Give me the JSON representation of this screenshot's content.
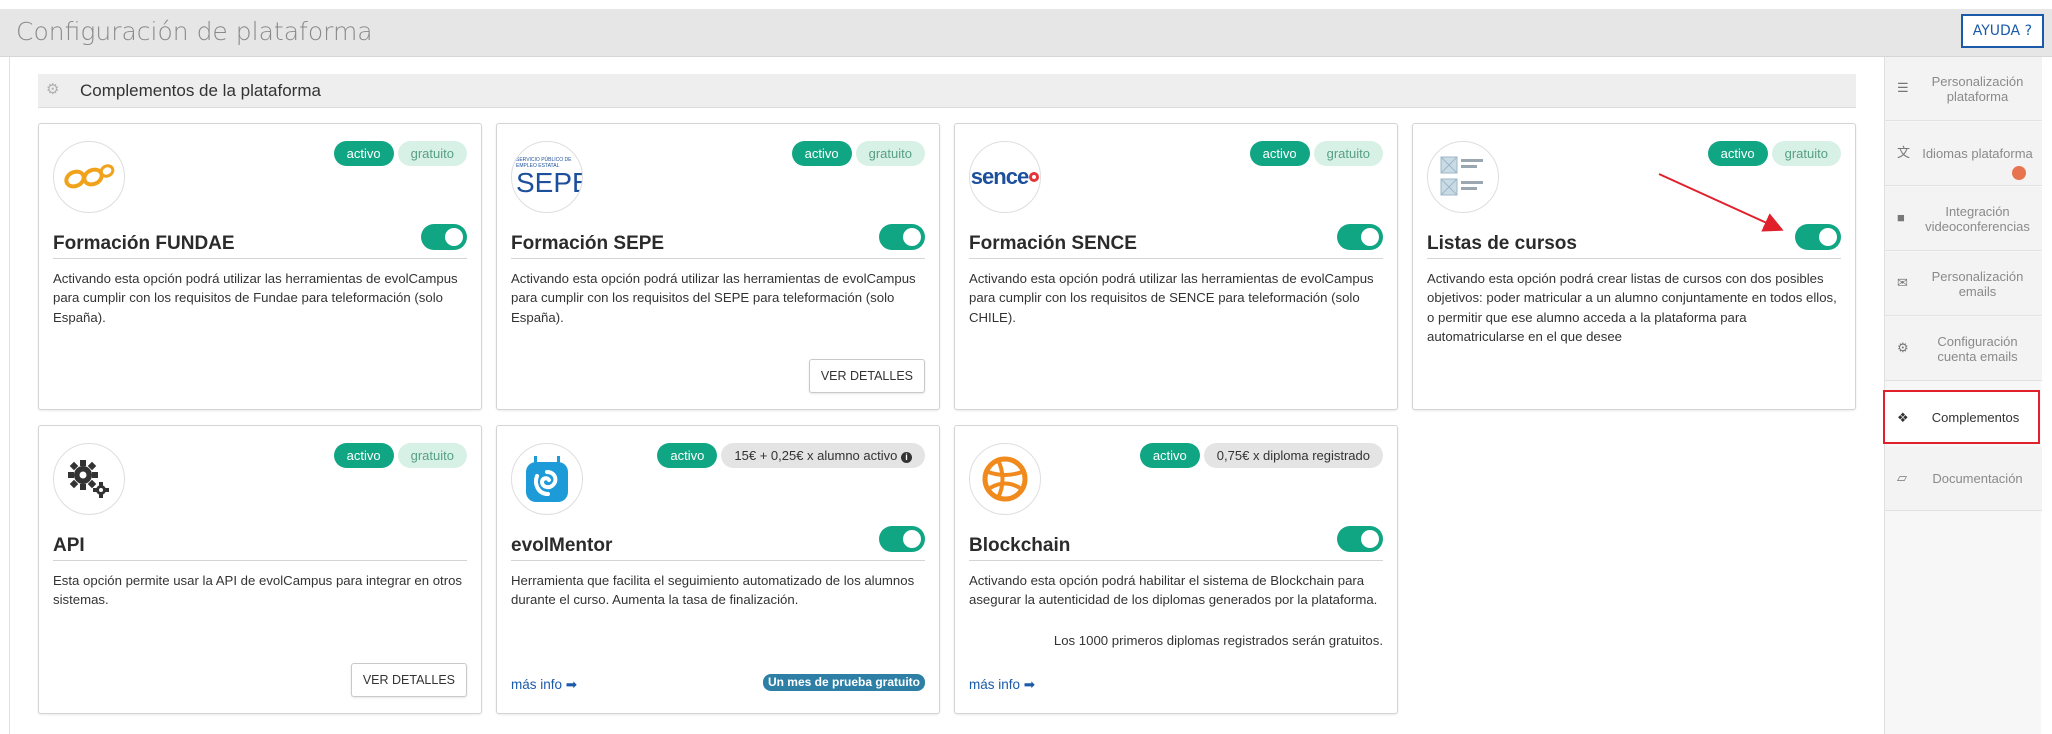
{
  "header": {
    "title": "Configuración de plataforma",
    "help_label": "AYUDA ?"
  },
  "section": {
    "title": "Complementos de la plataforma"
  },
  "cards": [
    {
      "title": "Formación FUNDAE",
      "status": "activo",
      "pricing": "gratuito",
      "description": "Activando esta opción podrá utilizar las herramientas de evolCampus para cumplir con los requisitos de Fundae para teleformación (solo España)."
    },
    {
      "title": "Formación SEPE",
      "status": "activo",
      "pricing": "gratuito",
      "logo_text": "SEPE",
      "logo_subtext": "SERVICIO PÚBLICO DE EMPLEO ESTATAL",
      "description": "Activando esta opción podrá utilizar las herramientas de evolCampus para cumplir con los requisitos del SEPE para teleformación (solo España).",
      "details_label": "VER DETALLES"
    },
    {
      "title": "Formación SENCE",
      "status": "activo",
      "pricing": "gratuito",
      "logo_text": "sence",
      "description": "Activando esta opción podrá utilizar las herramientas de evolCampus para cumplir con los requisitos de SENCE para teleformación (solo CHILE)."
    },
    {
      "title": "Listas de cursos",
      "status": "activo",
      "pricing": "gratuito",
      "description": "Activando esta opción podrá crear listas de cursos con dos posibles objetivos: poder matricular a un alumno conjuntamente en todos ellos, o permitir que ese alumno acceda a la plataforma para automatricularse en el que desee"
    },
    {
      "title": "API",
      "status": "activo",
      "pricing": "gratuito",
      "description": "Esta opción permite usar la API de evolCampus para integrar en otros sistemas.",
      "details_label": "VER DETALLES"
    },
    {
      "title": "evolMentor",
      "status": "activo",
      "pricing": "15€ + 0,25€ x alumno activo",
      "description": "Herramienta que facilita el seguimiento automatizado de los alumnos durante el curso. Aumenta la tasa de finalización.",
      "more_info": "más info",
      "trial": "Un mes de prueba gratuito"
    },
    {
      "title": "Blockchain",
      "status": "activo",
      "pricing": "0,75€ x diploma registrado",
      "description": "Activando esta opción podrá habilitar el sistema de Blockchain para asegurar la autenticidad de los diplomas generados por la plataforma.",
      "note": "Los 1000 primeros diplomas registrados serán gratuitos.",
      "more_info": "más info"
    }
  ],
  "sidebar": {
    "items": [
      {
        "label": "Personalización plataforma",
        "icon": "sliders-icon"
      },
      {
        "label": "Idiomas plataforma",
        "icon": "translate-icon"
      },
      {
        "label": "Integración videoconferencias",
        "icon": "video-icon"
      },
      {
        "label": "Personalización emails",
        "icon": "envelope-icon"
      },
      {
        "label": "Configuración cuenta emails",
        "icon": "gear-icon"
      },
      {
        "label": "Complementos",
        "icon": "cubes-icon"
      },
      {
        "label": "Documentación",
        "icon": "folder-open-icon"
      }
    ]
  },
  "colors": {
    "accent_green": "#11a683",
    "link_blue": "#1a5aa8",
    "highlight_red": "#e0202a"
  }
}
